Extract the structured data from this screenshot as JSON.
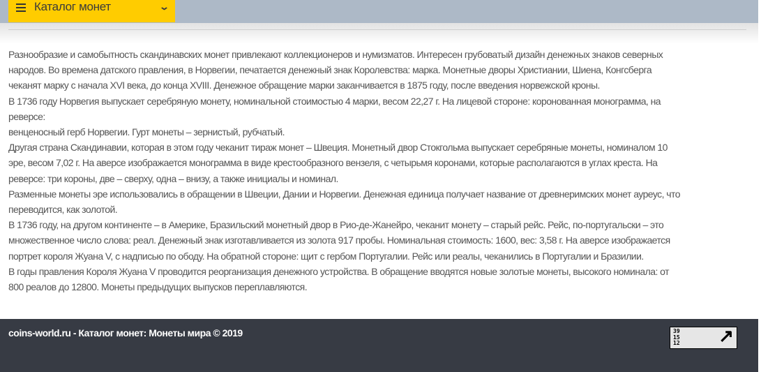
{
  "header": {
    "menu_label": "Каталог монет",
    "menu_icon": "hamburger-icon",
    "chevron_icon": "chevron-down-icon"
  },
  "article": {
    "lines": [
      "Разнообразие и самобытность скандинавских монет привлекают коллекционеров и нумизматов. Интересен грубоватый дизайн денежных знаков северных",
      "народов. Во времена датского правления, в Норвегии, печатается денежный знак Королевства: марка. Монетные дворы Христиании, Шиена, Конгсберга",
      "чеканят марку с начала XVI века, до конца XVIII. Денежное обращение марки заканчивается в 1875 году, после введения норвежской кроны.",
      "В 1736 году Норвегия выпускает серебряную монету, номинальной стоимостью 4 марки, весом 22,27 г. На лицевой стороне: коронованная монограмма, на",
      "реверсе:",
      "венценосный герб Норвегии. Гурт монеты – зернистый, рубчатый.",
      "Другая страна Скандинавии, которая в этом году чеканит тираж монет – Швеция. Монетный двор Стокгольма выпускает серебряные монеты, номиналом 10",
      "эре, весом 7,02 г. На аверсе изображается монограмма в виде крестообразного вензеля, с четырьмя коронами, которые располагаются в углах креста. На",
      "реверсе: три короны, две – сверху, одна – внизу, а также инициалы и номинал.",
      "Разменные монеты эре использовались в обращении в Швеции, Дании и Норвегии. Денежная единица получает название от древнеримских монет ауреус, что",
      "переводится, как золотой.",
      "В 1736 году, на другом континенте – в Америке, Бразильский монетный двор в Рио-де-Жанейро, чеканит монету – старый рейс. Рейс, по-португальски – это",
      "множественное число слова: реал. Денежный знак изготавливается из золота 917 пробы. Номинальная стоимость: 1600, вес: 3,58 г. На аверсе изображается",
      "портрет короля Жуана V, с надписью по ободу. На обратной стороне: щит с гербом Португалии. Рейс или реалы, чеканились в Португалии и Бразилии.",
      "В годы правления Короля Жуана V проводится реорганизация денежного устройства. В обращение вводятся новые золотые монеты, высокого номинала: от",
      "800 реалов до 12800. Монеты предыдущих выпусков переплавляются."
    ]
  },
  "footer": {
    "copyright": "coins-world.ru - Каталог монет: Монеты мира © 2019",
    "counter": {
      "values": [
        "39",
        "15",
        "12"
      ],
      "icon": "arrow-up-right-icon"
    }
  }
}
